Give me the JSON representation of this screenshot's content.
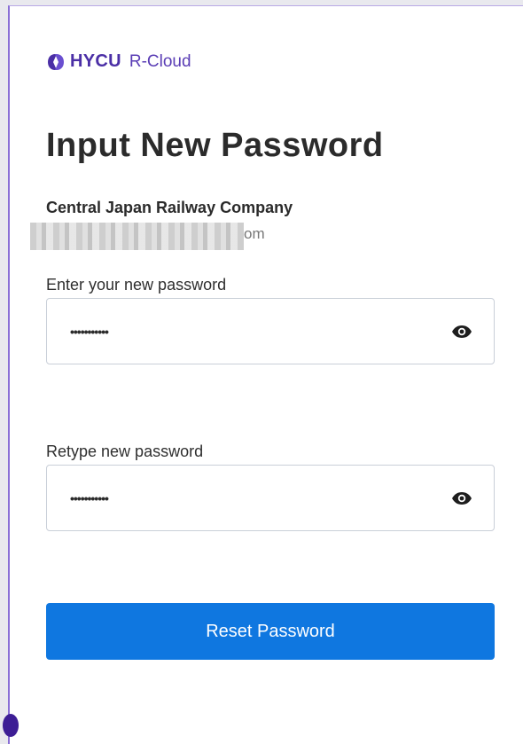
{
  "logo": {
    "brand": "HYCU",
    "product": "R-Cloud"
  },
  "page": {
    "title": "Input New Password"
  },
  "account": {
    "company": "Central Japan Railway Company",
    "email_visible_tail": "om"
  },
  "new_password": {
    "label": "Enter your new password",
    "value": "•••••••••••"
  },
  "retype_password": {
    "label": "Retype new password",
    "value": "•••••••••••"
  },
  "reset_button": {
    "label": "Reset Password"
  },
  "colors": {
    "brand": "#4b2fa6",
    "button": "#0f77e0",
    "text": "#2b2b2b"
  },
  "icons": {
    "logo": "hycu-logo-icon",
    "show_password": "eye-icon"
  }
}
